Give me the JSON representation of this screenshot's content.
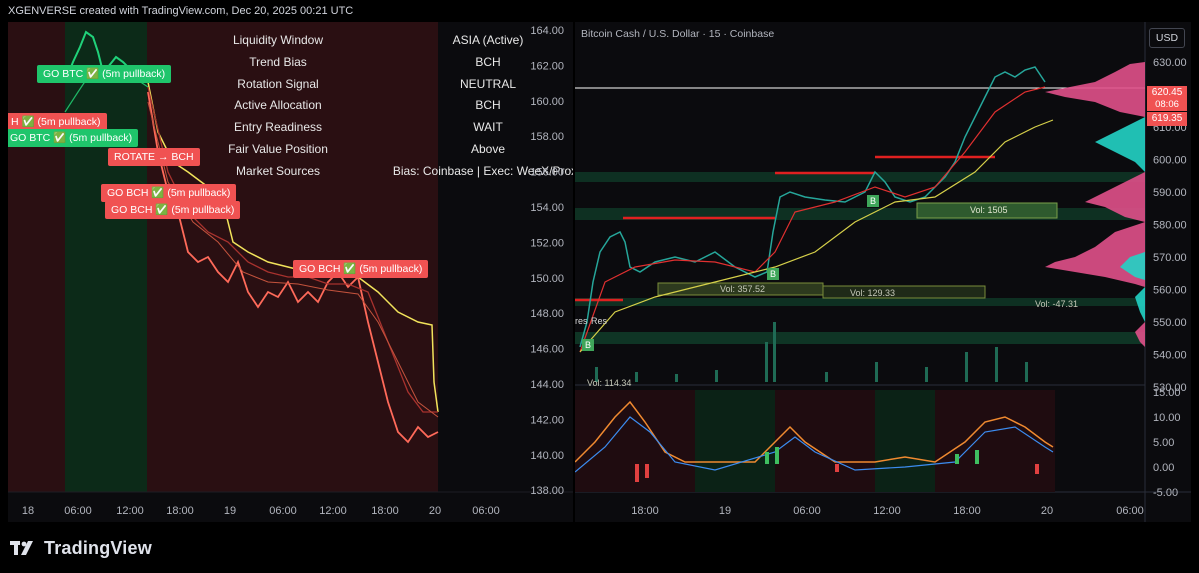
{
  "header": {
    "attribution": "XGENVERSE created with TradingView.com, Dec 20, 2025 00:21 UTC"
  },
  "left_chart": {
    "info_table": [
      {
        "label": "Liquidity Window",
        "value": "ASIA (Active)"
      },
      {
        "label": "Trend Bias",
        "value": "BCH"
      },
      {
        "label": "Rotation Signal",
        "value": "NEUTRAL"
      },
      {
        "label": "Active Allocation",
        "value": "BCH"
      },
      {
        "label": "Entry Readiness",
        "value": "WAIT"
      },
      {
        "label": "Fair Value Position",
        "value": "Above"
      },
      {
        "label": "Market Sources",
        "value": "Bias: Coinbase | Exec: WeeX/Proxy"
      }
    ],
    "signals": [
      {
        "text": "GO BTC ✅ (5m pullback)",
        "color": "green"
      },
      {
        "text": "H ✅ (5m pullback)",
        "color": "red"
      },
      {
        "text": "GO BTC ✅ (5m pullback)",
        "color": "green"
      },
      {
        "text": "ROTATE → BCH",
        "color": "red"
      },
      {
        "text": "GO BCH ✅ (5m pullback)",
        "color": "red"
      },
      {
        "text": "GO BCH ✅ (5m pullback)",
        "color": "red"
      },
      {
        "text": "GO BCH ✅ (5m pullback)",
        "color": "red"
      }
    ],
    "x_ticks": [
      "18",
      "06:00",
      "12:00",
      "18:00",
      "19",
      "06:00",
      "12:00",
      "18:00",
      "20",
      "06:00"
    ]
  },
  "right_chart": {
    "title": "Bitcoin Cash / U.S. Dollar · 15 · Coinbase",
    "currency_button": "USD",
    "left_price_axis": [
      "164.00",
      "162.00",
      "160.00",
      "158.00",
      "156.00",
      "154.00",
      "152.00",
      "150.00",
      "148.00",
      "146.00",
      "144.00",
      "142.00",
      "140.00",
      "138.00"
    ],
    "right_price_axis": [
      "630.00",
      "620.00",
      "610.00",
      "600.00",
      "590.00",
      "580.00",
      "570.00",
      "560.00",
      "550.00",
      "540.00",
      "530.00"
    ],
    "price_labels": [
      "620.45",
      "08:06",
      "619.35"
    ],
    "osc_axis": [
      "15.00",
      "10.00",
      "5.00",
      "0.00",
      "-5.00"
    ],
    "x_ticks": [
      "18:00",
      "19",
      "06:00",
      "12:00",
      "18:00",
      "20",
      "06:00"
    ],
    "vol_labels": [
      "Vol: 357.52",
      "Vol: 129.33",
      "Vol: -47.31",
      "Vol: 1505",
      "Vol: 114.34"
    ],
    "small_labels": [
      "B",
      "B",
      "B",
      "res",
      "Res"
    ]
  },
  "footer": {
    "brand": "TradingView"
  },
  "colors": {
    "green": "#1fc56b",
    "red": "#f05252",
    "yellow": "#f2e35b",
    "teal": "#22d3c5",
    "magenta": "#e0508a"
  }
}
